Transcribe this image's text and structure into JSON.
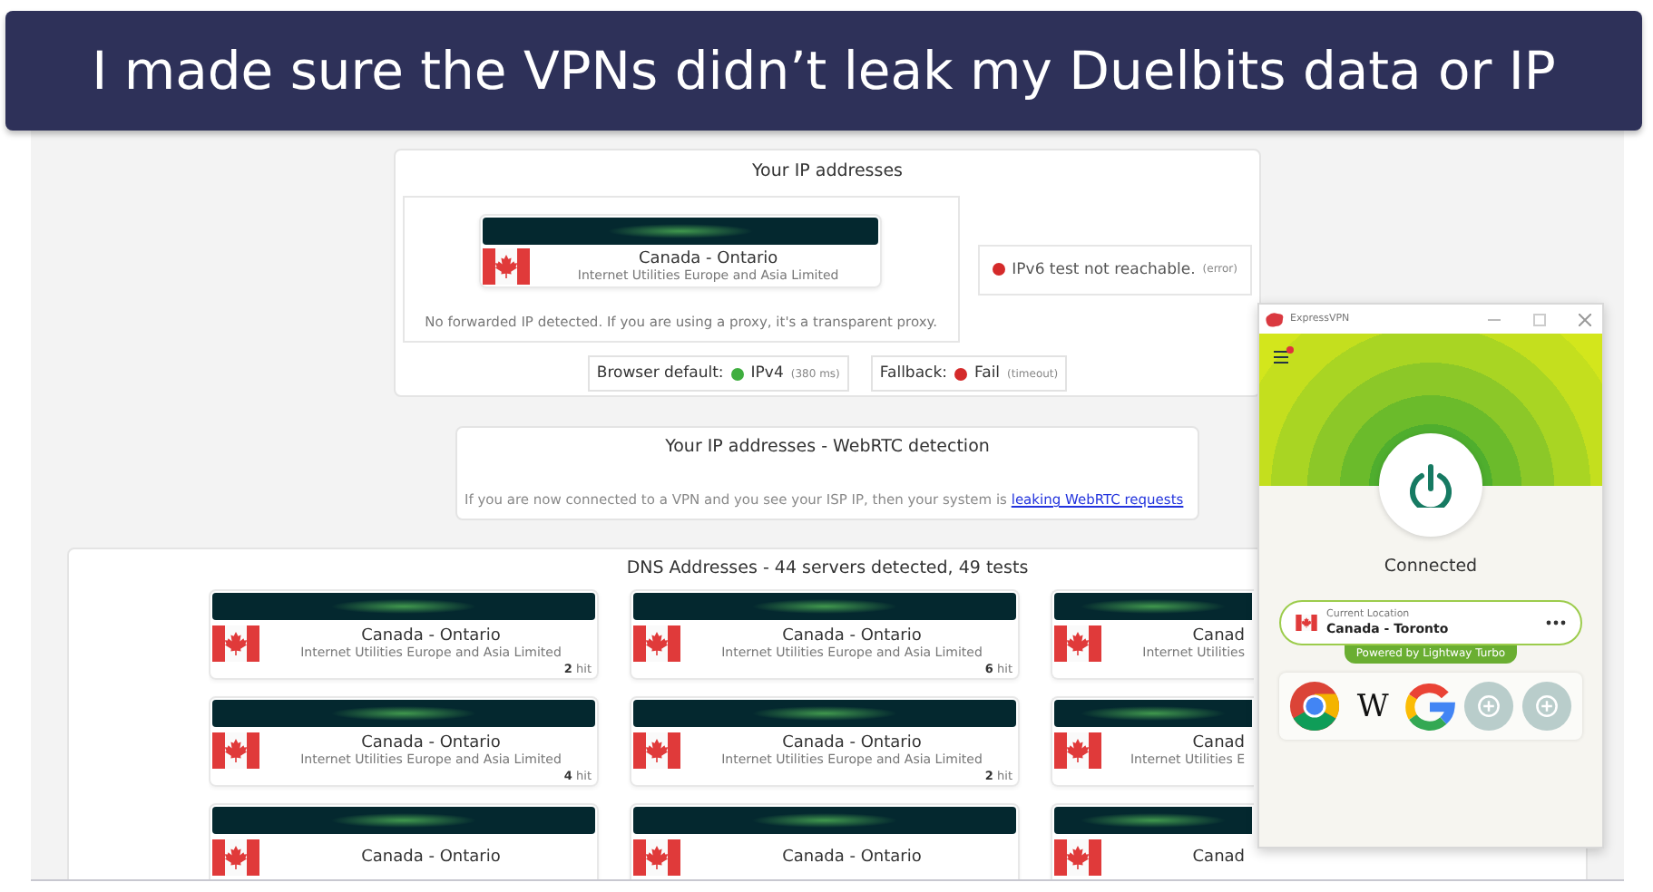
{
  "banner": {
    "title": "I made sure the VPNs didn’t leak my Duelbits data or IP"
  },
  "ip_panel": {
    "title": "Your IP addresses",
    "entry": {
      "location": "Canada - Ontario",
      "isp": "Internet Utilities Europe and Asia Limited"
    },
    "note": "No forwarded IP detected. If you are using a proxy, it's a transparent proxy.",
    "ipv6": {
      "status": "IPv6 test not reachable.",
      "detail": "(error)",
      "color": "#d42a2a"
    },
    "checks": [
      {
        "label": "Browser default:",
        "result": "IPv4",
        "detail": "(380 ms)",
        "color": "#3fae3f"
      },
      {
        "label": "Fallback:",
        "result": "Fail",
        "detail": "(timeout)",
        "color": "#d42a2a"
      }
    ]
  },
  "webrtc": {
    "title": "Your IP addresses - WebRTC detection",
    "message": "If you are now connected to a VPN and you see your ISP IP, then your system is",
    "link": "leaking WebRTC requests"
  },
  "dns": {
    "title": "DNS Addresses - 44 servers detected, 49 tests",
    "servers": [
      {
        "kind": "full",
        "location": "Canada - Ontario",
        "isp": "Internet Utilities Europe and Asia Limited",
        "hits": "**2** hit"
      },
      {
        "kind": "full",
        "location": "Canada - Ontario",
        "isp": "Internet Utilities Europe and Asia Limited",
        "hits": "**6** hit"
      },
      {
        "kind": "partial",
        "location": "Canad",
        "isp": "Internet Utilities"
      },
      {
        "kind": "full",
        "location": "Canada - Ontario",
        "isp": "Internet Utilities Europe and Asia Limited",
        "hits": "**4** hit"
      },
      {
        "kind": "full",
        "location": "Canada - Ontario",
        "isp": "Internet Utilities Europe and Asia Limited",
        "hits": "**2** hit"
      },
      {
        "kind": "partial",
        "location": "Canad",
        "isp": "Internet Utilities E"
      },
      {
        "kind": "full",
        "location": "Canada - Ontario"
      },
      {
        "kind": "full",
        "location": "Canada - Ontario"
      },
      {
        "kind": "partial",
        "location": "Canad"
      }
    ]
  },
  "vpn_app": {
    "title": "ExpressVPN",
    "status": "Connected",
    "location_label": "Current Location",
    "location": "Canada - Toronto",
    "badge": "Powered by Lightway Turbo",
    "shortcuts": [
      {
        "kind": "chrome"
      },
      {
        "kind": "wikipedia",
        "label": "W"
      },
      {
        "kind": "google"
      },
      {
        "kind": "add"
      },
      {
        "kind": "add"
      }
    ]
  }
}
